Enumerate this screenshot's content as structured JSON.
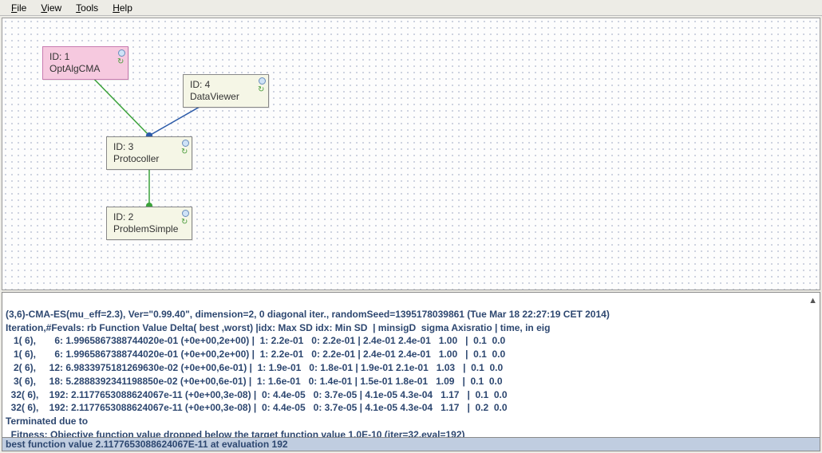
{
  "menu": {
    "file": "File",
    "view": "View",
    "tools": "Tools",
    "help": "Help"
  },
  "nodes": {
    "n1": {
      "id": "ID: 1",
      "name": "OptAlgCMA"
    },
    "n3": {
      "id": "ID: 3",
      "name": "Protocoller"
    },
    "n2": {
      "id": "ID: 2",
      "name": "ProblemSimple"
    },
    "n4": {
      "id": "ID: 4",
      "name": "DataViewer"
    }
  },
  "console": {
    "line0": "(3,6)-CMA-ES(mu_eff=2.3), Ver=\"0.99.40\", dimension=2, 0 diagonal iter., randomSeed=1395178039861 (Tue Mar 18 22:27:19 CET 2014)",
    "line1": "Iteration,#Fevals: rb Function Value Delta( best ,worst) |idx: Max SD idx: Min SD  | minsigD  sigma Axisratio | time, in eig",
    "line2": "   1( 6),       6: 1.9965867388744020e-01 (+0e+00,2e+00) |  1: 2.2e-01   0: 2.2e-01 | 2.4e-01 2.4e-01   1.00   |  0.1  0.0",
    "line3": "   1( 6),       6: 1.9965867388744020e-01 (+0e+00,2e+00) |  1: 2.2e-01   0: 2.2e-01 | 2.4e-01 2.4e-01   1.00   |  0.1  0.0",
    "line4": "   2( 6),     12: 6.9833975181269630e-02 (+0e+00,6e-01) |  1: 1.9e-01   0: 1.8e-01 | 1.9e-01 2.1e-01   1.03   |  0.1  0.0",
    "line5": "   3( 6),     18: 5.2888392341198850e-02 (+0e+00,6e-01) |  1: 1.6e-01   0: 1.4e-01 | 1.5e-01 1.8e-01   1.09   |  0.1  0.0",
    "line6": "  32( 6),    192: 2.1177653088624067e-11 (+0e+00,3e-08) |  0: 4.4e-05   0: 3.7e-05 | 4.1e-05 4.3e-04   1.17   |  0.1  0.0",
    "line7": "  32( 6),    192: 2.1177653088624067e-11 (+0e+00,3e-08) |  0: 4.4e-05   0: 3.7e-05 | 4.1e-05 4.3e-04   1.17   |  0.2  0.0",
    "line8": "Terminated due to",
    "line9": "  Fitness: Objective function value dropped below the target function value 1.0E-10 (iter=32,eval=192)",
    "status": "best function value 2.1177653088624067E-11 at evaluation 192"
  }
}
